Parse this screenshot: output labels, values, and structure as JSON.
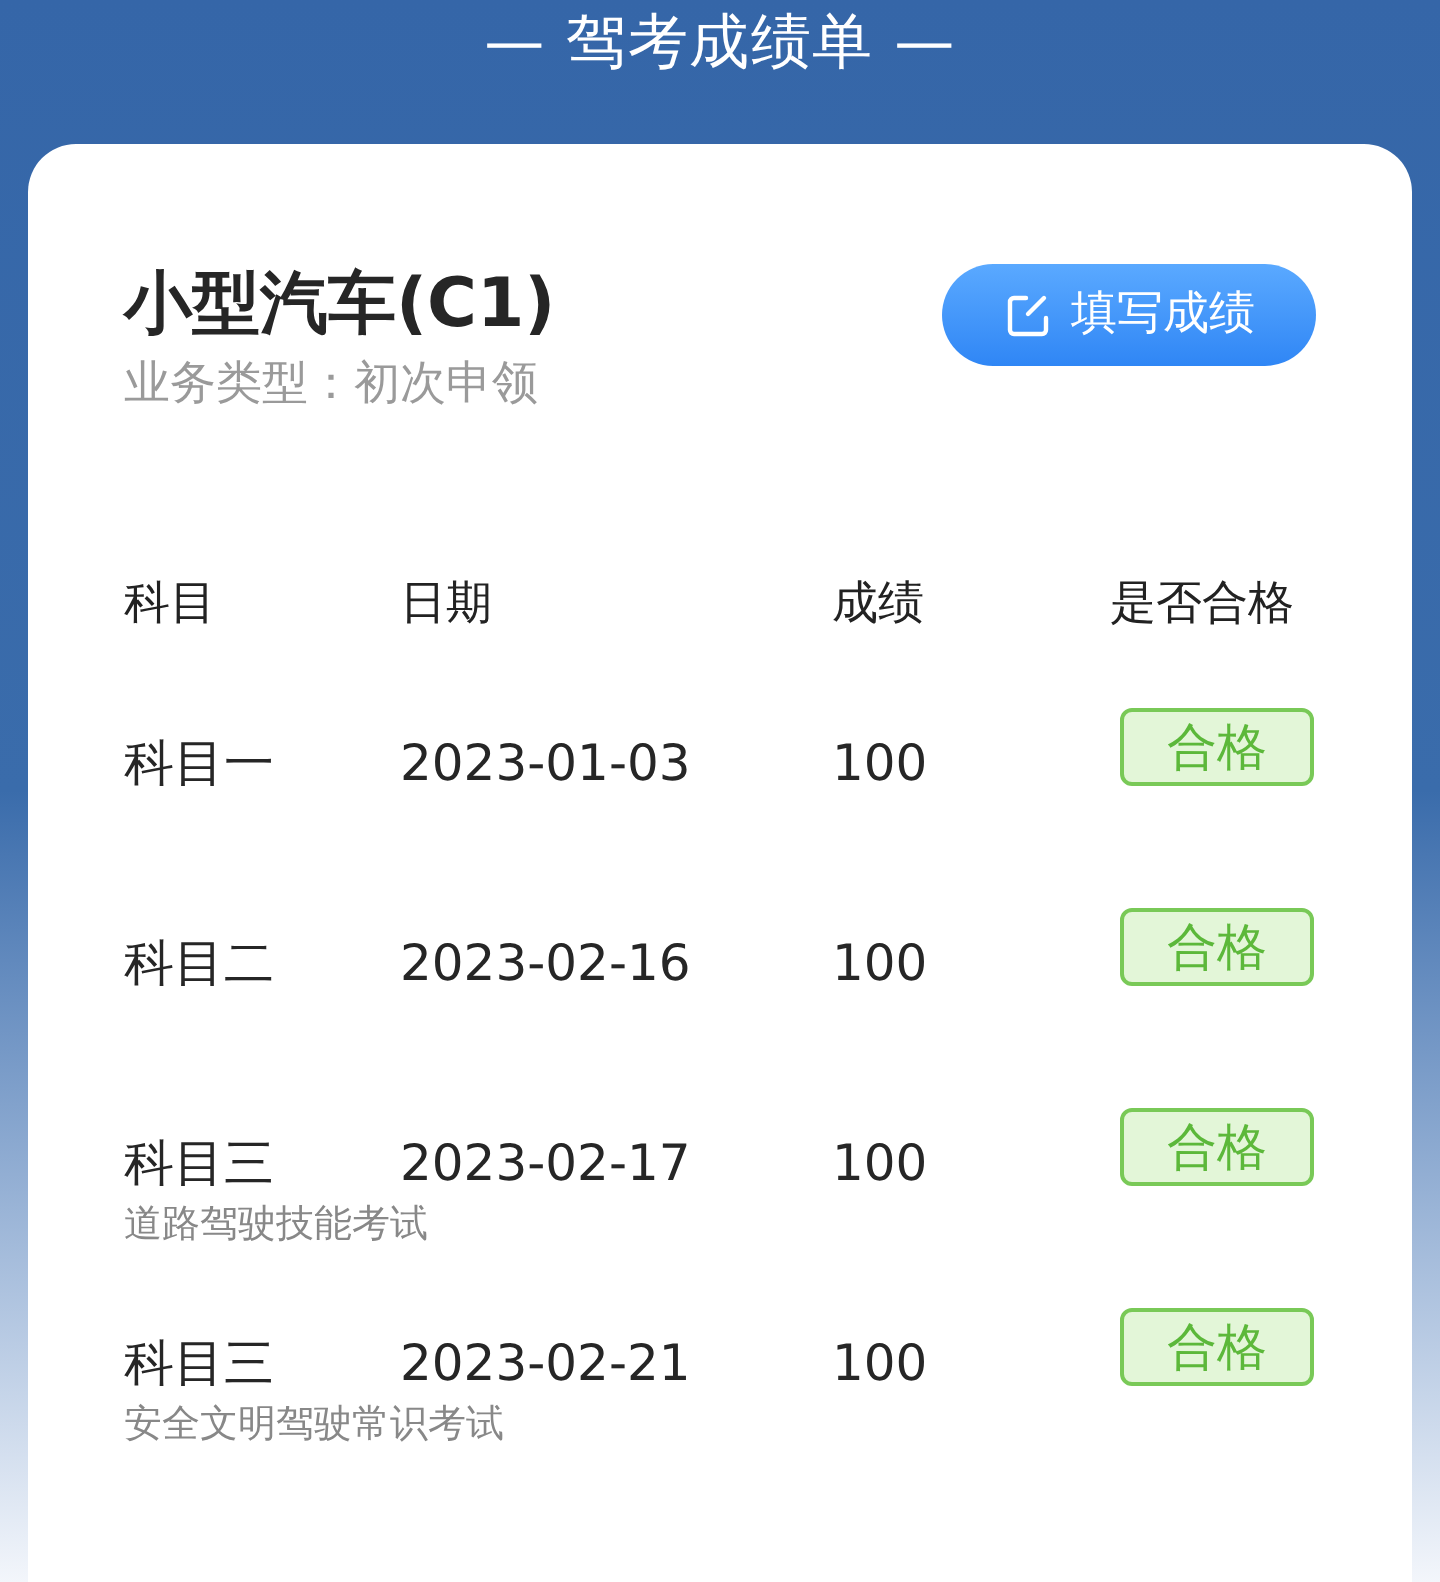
{
  "header": {
    "title": "— 驾考成绩单 —"
  },
  "card": {
    "vehicle": "小型汽车(C1)",
    "business_type": "业务类型：初次申领",
    "action_button": "填写成绩"
  },
  "table": {
    "columns": [
      "科目",
      "日期",
      "成绩",
      "是否合格"
    ],
    "rows": [
      {
        "subject": "科目一",
        "date": "2023-01-03",
        "score": "100",
        "result": "合格"
      },
      {
        "subject": "科目二",
        "date": "2023-02-16",
        "score": "100",
        "result": "合格"
      },
      {
        "subject": "科目三",
        "note": "道路驾驶技能考试",
        "date": "2023-02-17",
        "score": "100",
        "result": "合格"
      },
      {
        "subject": "科目三",
        "note": "安全文明驾驶常识考试",
        "date": "2023-02-21",
        "score": "100",
        "result": "合格"
      }
    ]
  }
}
